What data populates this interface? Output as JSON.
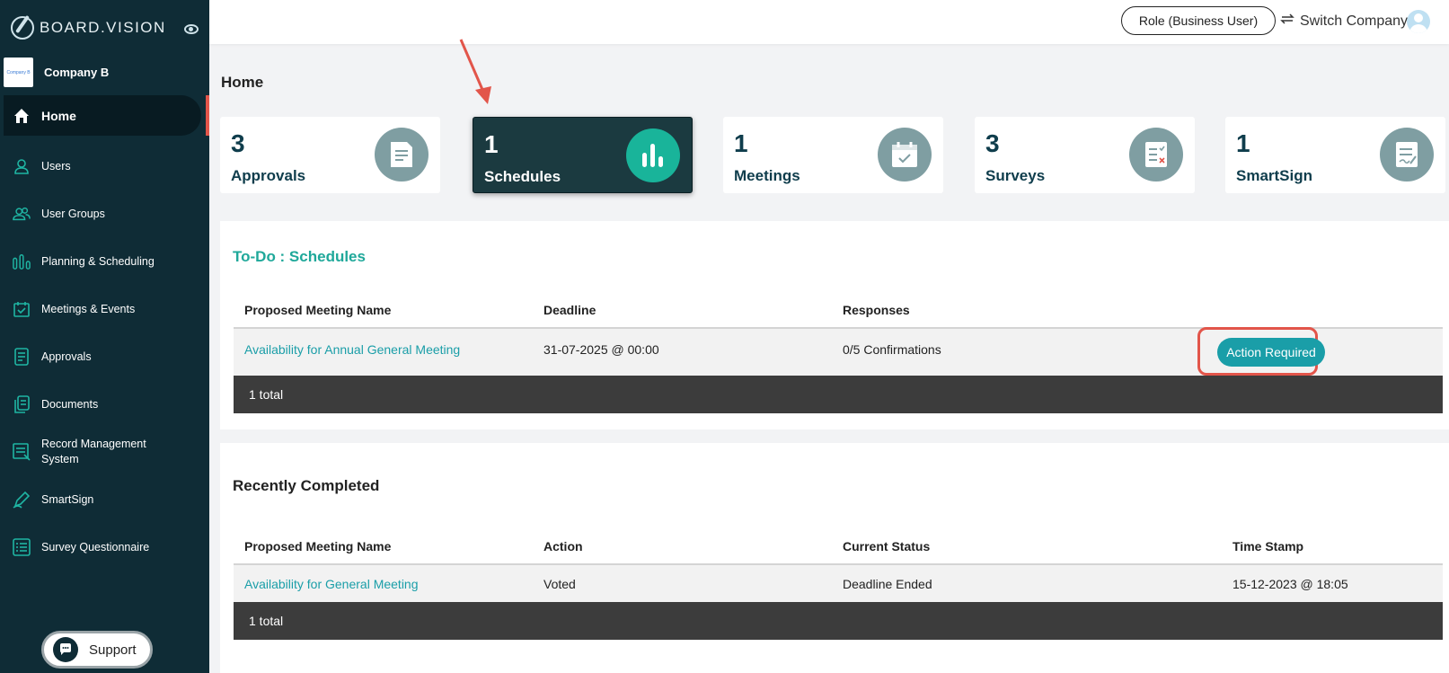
{
  "brand": {
    "name": "BOARD.VISION"
  },
  "company": {
    "name": "Company B",
    "logo_text": "Company B"
  },
  "nav": [
    {
      "label": "Home",
      "icon": "home-icon",
      "active": true
    },
    {
      "label": "Users",
      "icon": "user-icon"
    },
    {
      "label": "User Groups",
      "icon": "users-icon"
    },
    {
      "label": "Planning & Scheduling",
      "icon": "bar-chart-icon"
    },
    {
      "label": "Meetings & Events",
      "icon": "calendar-check-icon"
    },
    {
      "label": "Approvals",
      "icon": "document-icon"
    },
    {
      "label": "Documents",
      "icon": "documents-icon"
    },
    {
      "label": "Record Management System",
      "icon": "record-icon"
    },
    {
      "label": "SmartSign",
      "icon": "pen-icon"
    },
    {
      "label": "Survey Questionnaire",
      "icon": "list-icon"
    }
  ],
  "support": {
    "label": "Support"
  },
  "topbar": {
    "role_label": "Role (Business User)",
    "switch_label": "Switch Company"
  },
  "page": {
    "title": "Home"
  },
  "cards": [
    {
      "count": "3",
      "label": "Approvals",
      "icon": "document-icon"
    },
    {
      "count": "1",
      "label": "Schedules",
      "icon": "bar-chart-icon",
      "active": true
    },
    {
      "count": "1",
      "label": "Meetings",
      "icon": "calendar-icon"
    },
    {
      "count": "3",
      "label": "Surveys",
      "icon": "checklist-icon"
    },
    {
      "count": "1",
      "label": "SmartSign",
      "icon": "sign-icon"
    }
  ],
  "todo": {
    "title": "To-Do : Schedules",
    "headers": [
      "Proposed Meeting Name",
      "Deadline",
      "Responses"
    ],
    "rows": [
      {
        "name": "Availability for Annual General Meeting",
        "deadline": "31-07-2025 @ 00:00",
        "responses": "0/5 Confirmations",
        "action": "Action Required"
      }
    ],
    "total": "1 total"
  },
  "completed": {
    "title": "Recently Completed",
    "headers": [
      "Proposed Meeting Name",
      "Action",
      "Current Status",
      "Time Stamp"
    ],
    "rows": [
      {
        "name": "Availability for General Meeting",
        "action": "Voted",
        "status": "Deadline Ended",
        "timestamp": "15-12-2023 @ 18:05"
      }
    ],
    "total": "1 total"
  },
  "colors": {
    "sidebar": "#0f2c36",
    "accent": "#1a9ea8",
    "highlight": "#e2554a",
    "teal": "#19b49a"
  }
}
